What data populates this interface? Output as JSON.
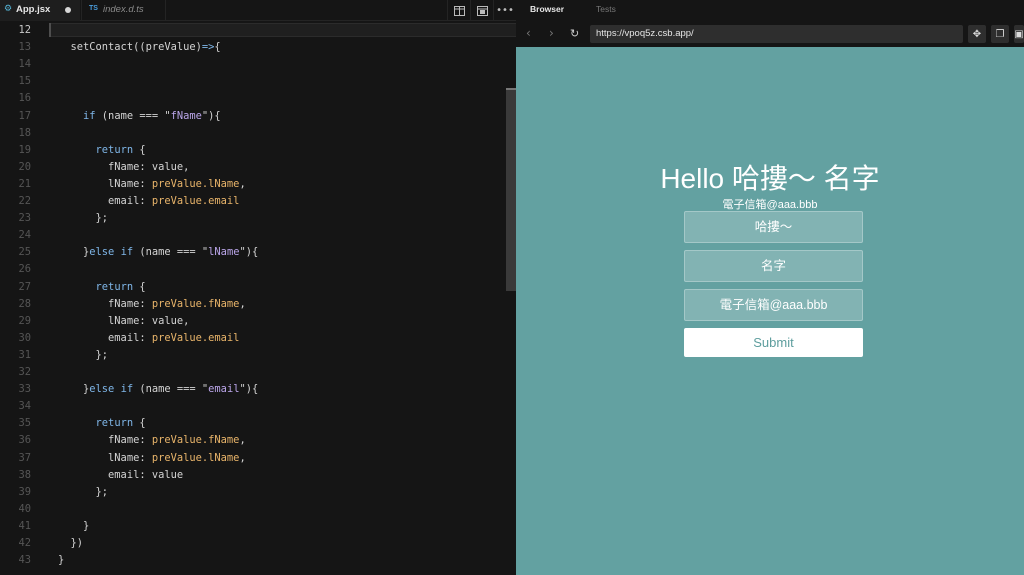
{
  "editor": {
    "tabs": [
      {
        "label": "App.jsx",
        "icon": "react-gear-icon",
        "modified": true
      },
      {
        "label": "index.d.ts",
        "badge": "TS"
      }
    ],
    "actions": [
      "split-view-icon",
      "preview-icon",
      "more-icon"
    ],
    "active_line": "12",
    "lines": [
      {
        "n": "12",
        "t": ""
      },
      {
        "n": "13",
        "t": "  setContact((preValue)=>{"
      },
      {
        "n": "14",
        "t": ""
      },
      {
        "n": "15",
        "t": ""
      },
      {
        "n": "16",
        "t": ""
      },
      {
        "n": "17",
        "t": "    if (name === \"fName\"){"
      },
      {
        "n": "18",
        "t": ""
      },
      {
        "n": "19",
        "t": "      return {"
      },
      {
        "n": "20",
        "t": "        fName: value,"
      },
      {
        "n": "21",
        "t": "        lName: preValue.lName,"
      },
      {
        "n": "22",
        "t": "        email: preValue.email"
      },
      {
        "n": "23",
        "t": "      };"
      },
      {
        "n": "24",
        "t": ""
      },
      {
        "n": "25",
        "t": "    }else if (name === \"lName\"){"
      },
      {
        "n": "26",
        "t": ""
      },
      {
        "n": "27",
        "t": "      return {"
      },
      {
        "n": "28",
        "t": "        fName: preValue.fName,"
      },
      {
        "n": "29",
        "t": "        lName: value,"
      },
      {
        "n": "30",
        "t": "        email: preValue.email"
      },
      {
        "n": "31",
        "t": "      };"
      },
      {
        "n": "32",
        "t": ""
      },
      {
        "n": "33",
        "t": "    }else if (name === \"email\"){"
      },
      {
        "n": "34",
        "t": ""
      },
      {
        "n": "35",
        "t": "      return {"
      },
      {
        "n": "36",
        "t": "        fName: preValue.fName,"
      },
      {
        "n": "37",
        "t": "        lName: preValue.lName,"
      },
      {
        "n": "38",
        "t": "        email: value"
      },
      {
        "n": "39",
        "t": "      };"
      },
      {
        "n": "40",
        "t": ""
      },
      {
        "n": "41",
        "t": "    }"
      },
      {
        "n": "42",
        "t": "  })"
      },
      {
        "n": "43",
        "t": "}"
      }
    ]
  },
  "preview": {
    "tabs": {
      "browser": "Browser",
      "tests": "Tests"
    },
    "url": "https://vpoq5z.csb.app/",
    "page": {
      "heading": "Hello 哈摟～ 名字",
      "email_line": "電子信箱@aaa.bbb",
      "inputs": [
        "哈摟～",
        "名字",
        "電子信箱@aaa.bbb"
      ],
      "submit_label": "Submit"
    }
  },
  "colors": {
    "editor_bg": "#151515",
    "page_bg": "#63a1a1",
    "keyword": "#7fb6e8",
    "string": "#bba6ea",
    "property": "#e8b46a"
  }
}
